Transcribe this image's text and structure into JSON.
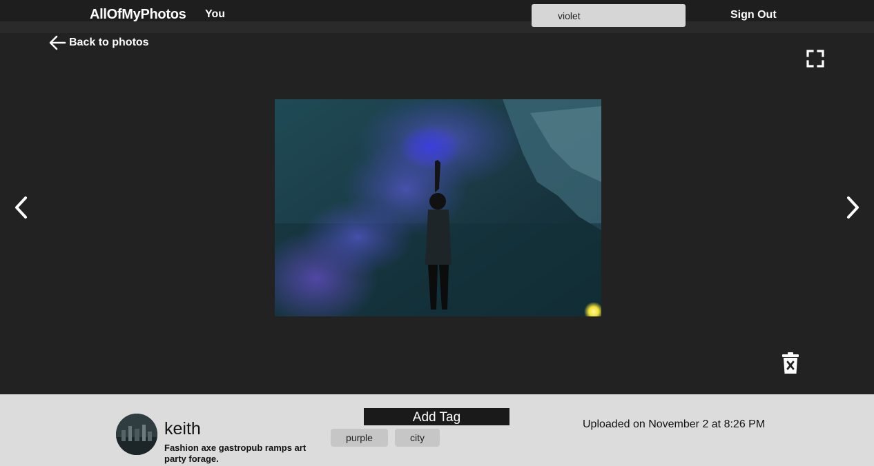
{
  "header": {
    "brand": "AllOfMyPhotos",
    "nav_you": "You",
    "search": {
      "value": "violet",
      "placeholder": ""
    },
    "sign_out": "Sign Out"
  },
  "viewer": {
    "back_label": "Back to photos",
    "icons": {
      "back": "arrow-left-icon",
      "fullscreen": "expand-icon",
      "prev": "chevron-left-icon",
      "next": "chevron-right-icon",
      "delete": "trash-x-icon"
    }
  },
  "photo_info": {
    "username": "keith",
    "bio": "Fashion axe gastropub ramps art party forage.",
    "add_tag_label": "Add Tag",
    "tags": [
      "purple",
      "city"
    ],
    "uploaded": "Uploaded on November 2 at 8:26 PM"
  },
  "colors": {
    "background": "#222222",
    "topbar": "#1e1e1e",
    "panel": "#dcdcdc",
    "search_bg": "#d6d6d6",
    "tag_bg": "#c6c6c6",
    "add_tag_bg": "#1a1a1a"
  }
}
